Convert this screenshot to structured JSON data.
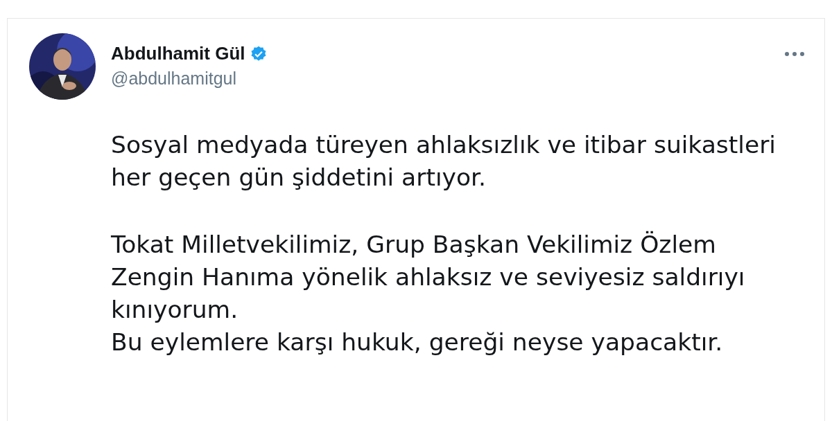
{
  "tweet": {
    "author": {
      "name": "Abdulhamit Gül",
      "verified": true,
      "handle": "@abdulhamitgul"
    },
    "paragraphs": [
      {
        "lines": [
          "Sosyal medyada türeyen ahlaksızlık ve itibar suikastleri",
          "her geçen gün şiddetini artıyor."
        ]
      },
      {
        "lines": [
          "Tokat Milletvekilimiz, Grup Başkan Vekilimiz Özlem",
          "Zengin Hanıma yönelik ahlaksız ve seviyesiz saldırıyı",
          "kınıyorum.",
          "Bu eylemlere karşı hukuk, gereği neyse yapacaktır."
        ]
      }
    ]
  }
}
